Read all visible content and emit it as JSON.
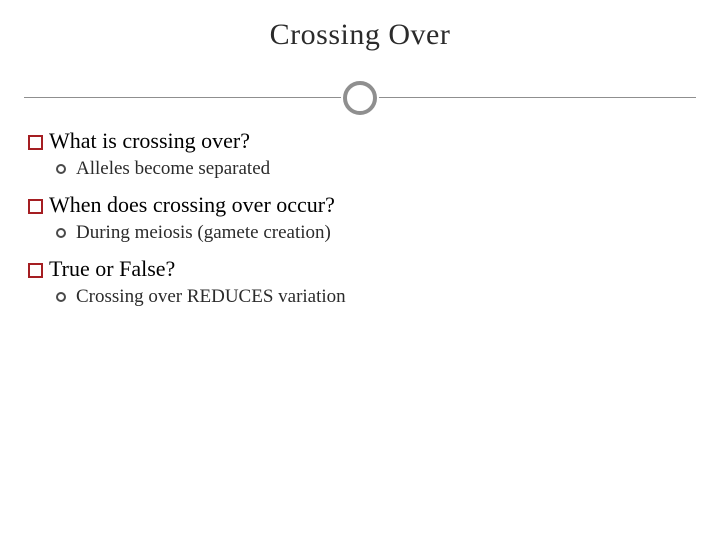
{
  "title": "Crossing Over",
  "items": [
    {
      "text": "What is crossing over?",
      "sub": {
        "text": "Alleles become separated"
      }
    },
    {
      "text": "When does crossing over occur?",
      "sub": {
        "text": "During meiosis (gamete creation)"
      }
    },
    {
      "text": "True or False?",
      "sub": {
        "text": "Crossing over REDUCES variation"
      }
    }
  ]
}
